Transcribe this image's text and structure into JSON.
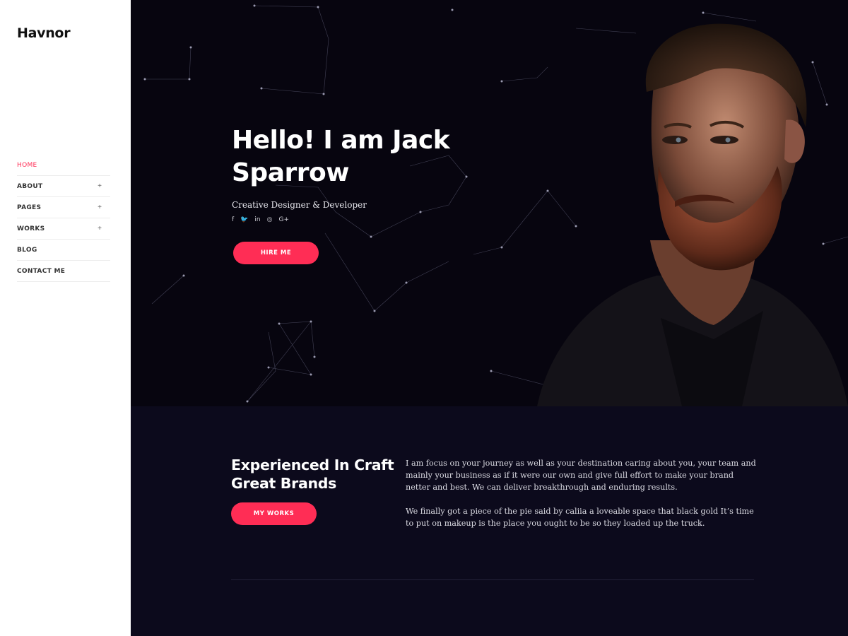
{
  "sidebar": {
    "logo": "Havnor",
    "nav": [
      {
        "label": "HOME",
        "has_submenu": false,
        "active": true
      },
      {
        "label": "ABOUT",
        "has_submenu": true,
        "active": false
      },
      {
        "label": "PAGES",
        "has_submenu": true,
        "active": false
      },
      {
        "label": "WORKS",
        "has_submenu": true,
        "active": false
      },
      {
        "label": "BLOG",
        "has_submenu": false,
        "active": false
      },
      {
        "label": "CONTACT ME",
        "has_submenu": false,
        "active": false
      }
    ],
    "submenu_icon": "+"
  },
  "hero": {
    "title": "Hello! I am Jack Sparrow",
    "subtitle": "Creative Designer & Developer",
    "social": [
      {
        "icon": "facebook-icon",
        "glyph": "f"
      },
      {
        "icon": "twitter-icon",
        "glyph": "🐦"
      },
      {
        "icon": "linkedin-icon",
        "glyph": "in"
      },
      {
        "icon": "instagram-icon",
        "glyph": "◎"
      },
      {
        "icon": "google-plus-icon",
        "glyph": "G+"
      }
    ],
    "button": "HIRE ME"
  },
  "about": {
    "title": "Experienced In Craft Great Brands",
    "button": "MY WORKS",
    "paragraph1": "I am focus on your journey as well as your destination caring about you, your team and mainly your business as if it were our own and give full effort to make your brand netter and best. We can deliver breakthrough and enduring results.",
    "paragraph2": "We finally got a piece of the pie said by caliia a loveable space that black gold It’s time to put on makeup is the place you ought to be so they loaded up the truck."
  },
  "colors": {
    "accent": "#ff2d55",
    "hero_bg": "#07050f",
    "section_bg": "#0c0a1c",
    "sidebar_bg": "#ffffff"
  }
}
